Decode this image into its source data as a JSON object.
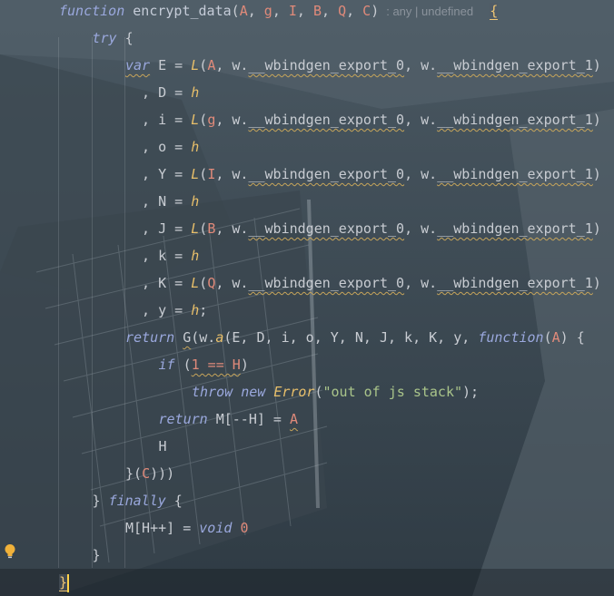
{
  "editor": {
    "lines": [
      {
        "indent": 0,
        "tokens": [
          {
            "t": "function",
            "c": "kw"
          },
          {
            "t": " "
          },
          {
            "t": "encrypt_data",
            "c": "fn"
          },
          {
            "t": "("
          },
          {
            "t": "A",
            "c": "param"
          },
          {
            "t": ", "
          },
          {
            "t": "g",
            "c": "param"
          },
          {
            "t": ", "
          },
          {
            "t": "I",
            "c": "param"
          },
          {
            "t": ", "
          },
          {
            "t": "B",
            "c": "param"
          },
          {
            "t": ", "
          },
          {
            "t": "Q",
            "c": "param"
          },
          {
            "t": ", "
          },
          {
            "t": "C",
            "c": "param"
          },
          {
            "t": ")"
          },
          {
            "t": ": any | undefined",
            "c": "hint"
          },
          {
            "t": "  "
          },
          {
            "t": "{",
            "c": "brace-hl"
          }
        ]
      },
      {
        "indent": 1,
        "tokens": [
          {
            "t": "try",
            "c": "kw"
          },
          {
            "t": " {"
          }
        ]
      },
      {
        "indent": 2,
        "tokens": [
          {
            "t": "var",
            "c": "kw squig"
          },
          {
            "t": " E = "
          },
          {
            "t": "L",
            "c": "italic-yellow"
          },
          {
            "t": "("
          },
          {
            "t": "A",
            "c": "param"
          },
          {
            "t": ", w."
          },
          {
            "t": "__wbindgen_export_0",
            "c": "squig"
          },
          {
            "t": ", w."
          },
          {
            "t": "__wbindgen_export_1",
            "c": "squig"
          },
          {
            "t": ")"
          }
        ]
      },
      {
        "indent": 2,
        "tokens": [
          {
            "t": "  , D = "
          },
          {
            "t": "h",
            "c": "italic-yellow"
          }
        ]
      },
      {
        "indent": 2,
        "tokens": [
          {
            "t": "  , i = "
          },
          {
            "t": "L",
            "c": "italic-yellow"
          },
          {
            "t": "("
          },
          {
            "t": "g",
            "c": "param"
          },
          {
            "t": ", w."
          },
          {
            "t": "__wbindgen_export_0",
            "c": "squig"
          },
          {
            "t": ", w."
          },
          {
            "t": "__wbindgen_export_1",
            "c": "squig"
          },
          {
            "t": ")"
          }
        ]
      },
      {
        "indent": 2,
        "tokens": [
          {
            "t": "  , o = "
          },
          {
            "t": "h",
            "c": "italic-yellow"
          }
        ]
      },
      {
        "indent": 2,
        "tokens": [
          {
            "t": "  , Y = "
          },
          {
            "t": "L",
            "c": "italic-yellow"
          },
          {
            "t": "("
          },
          {
            "t": "I",
            "c": "param"
          },
          {
            "t": ", w."
          },
          {
            "t": "__wbindgen_export_0",
            "c": "squig"
          },
          {
            "t": ", w."
          },
          {
            "t": "__wbindgen_export_1",
            "c": "squig"
          },
          {
            "t": ")"
          }
        ]
      },
      {
        "indent": 2,
        "tokens": [
          {
            "t": "  , N = "
          },
          {
            "t": "h",
            "c": "italic-yellow"
          }
        ]
      },
      {
        "indent": 2,
        "tokens": [
          {
            "t": "  , J = "
          },
          {
            "t": "L",
            "c": "italic-yellow"
          },
          {
            "t": "("
          },
          {
            "t": "B",
            "c": "param"
          },
          {
            "t": ", w."
          },
          {
            "t": "__wbindgen_export_0",
            "c": "squig"
          },
          {
            "t": ", w."
          },
          {
            "t": "__wbindgen_export_1",
            "c": "squig"
          },
          {
            "t": ")"
          }
        ]
      },
      {
        "indent": 2,
        "tokens": [
          {
            "t": "  , k = "
          },
          {
            "t": "h",
            "c": "italic-yellow"
          }
        ]
      },
      {
        "indent": 2,
        "tokens": [
          {
            "t": "  , K = "
          },
          {
            "t": "L",
            "c": "italic-yellow"
          },
          {
            "t": "("
          },
          {
            "t": "Q",
            "c": "param"
          },
          {
            "t": ", w."
          },
          {
            "t": "__wbindgen_export_0",
            "c": "squig"
          },
          {
            "t": ", w."
          },
          {
            "t": "__wbindgen_export_1",
            "c": "squig"
          },
          {
            "t": ")"
          }
        ]
      },
      {
        "indent": 2,
        "tokens": [
          {
            "t": "  , y = "
          },
          {
            "t": "h",
            "c": "italic-yellow"
          },
          {
            "t": ";"
          }
        ]
      },
      {
        "indent": 2,
        "tokens": [
          {
            "t": "return",
            "c": "kw"
          },
          {
            "t": " "
          },
          {
            "t": "G",
            "c": "squig"
          },
          {
            "t": "(w."
          },
          {
            "t": "a",
            "c": "italic-yellow"
          },
          {
            "t": "(E, D, i, o, Y, N, J, k, K, y, "
          },
          {
            "t": "function",
            "c": "kw"
          },
          {
            "t": "("
          },
          {
            "t": "A",
            "c": "param"
          },
          {
            "t": ") {"
          }
        ]
      },
      {
        "indent": 3,
        "tokens": [
          {
            "t": "if",
            "c": "kw"
          },
          {
            "t": " ("
          },
          {
            "t": "1 == H",
            "c": "squig num"
          },
          {
            "t": ")"
          }
        ]
      },
      {
        "indent": 4,
        "tokens": [
          {
            "t": "throw",
            "c": "kw"
          },
          {
            "t": " "
          },
          {
            "t": "new",
            "c": "kw"
          },
          {
            "t": " "
          },
          {
            "t": "Error",
            "c": "cls"
          },
          {
            "t": "("
          },
          {
            "t": "\"out of js stack\"",
            "c": "str"
          },
          {
            "t": ");"
          }
        ]
      },
      {
        "indent": 3,
        "tokens": [
          {
            "t": "return",
            "c": "kw"
          },
          {
            "t": " M[--H] = "
          },
          {
            "t": "A",
            "c": "param squig"
          }
        ]
      },
      {
        "indent": 3,
        "tokens": [
          {
            "t": "H"
          }
        ]
      },
      {
        "indent": 2,
        "tokens": [
          {
            "t": "}("
          },
          {
            "t": "C",
            "c": "param"
          },
          {
            "t": ")))"
          }
        ]
      },
      {
        "indent": 1,
        "tokens": [
          {
            "t": "} "
          },
          {
            "t": "finally",
            "c": "kw"
          },
          {
            "t": " {"
          }
        ]
      },
      {
        "indent": 2,
        "tokens": [
          {
            "t": "M[H++] = "
          },
          {
            "t": "void",
            "c": "kw"
          },
          {
            "t": " "
          },
          {
            "t": "0",
            "c": "num"
          }
        ]
      },
      {
        "indent": 1,
        "tokens": [
          {
            "t": "}"
          }
        ]
      },
      {
        "indent": 0,
        "tokens": [
          {
            "t": "}",
            "c": "brace-hl"
          }
        ],
        "current": true
      }
    ],
    "icons": {
      "gutter": "lightbulb-icon"
    },
    "colors": {
      "keyword": "#9aa8dd",
      "parameter": "#e08a7a",
      "function_call": "#e8bf6a",
      "string": "#a9c48a",
      "warning_underline": "#c7a55a",
      "caret": "#ffd24a"
    }
  }
}
